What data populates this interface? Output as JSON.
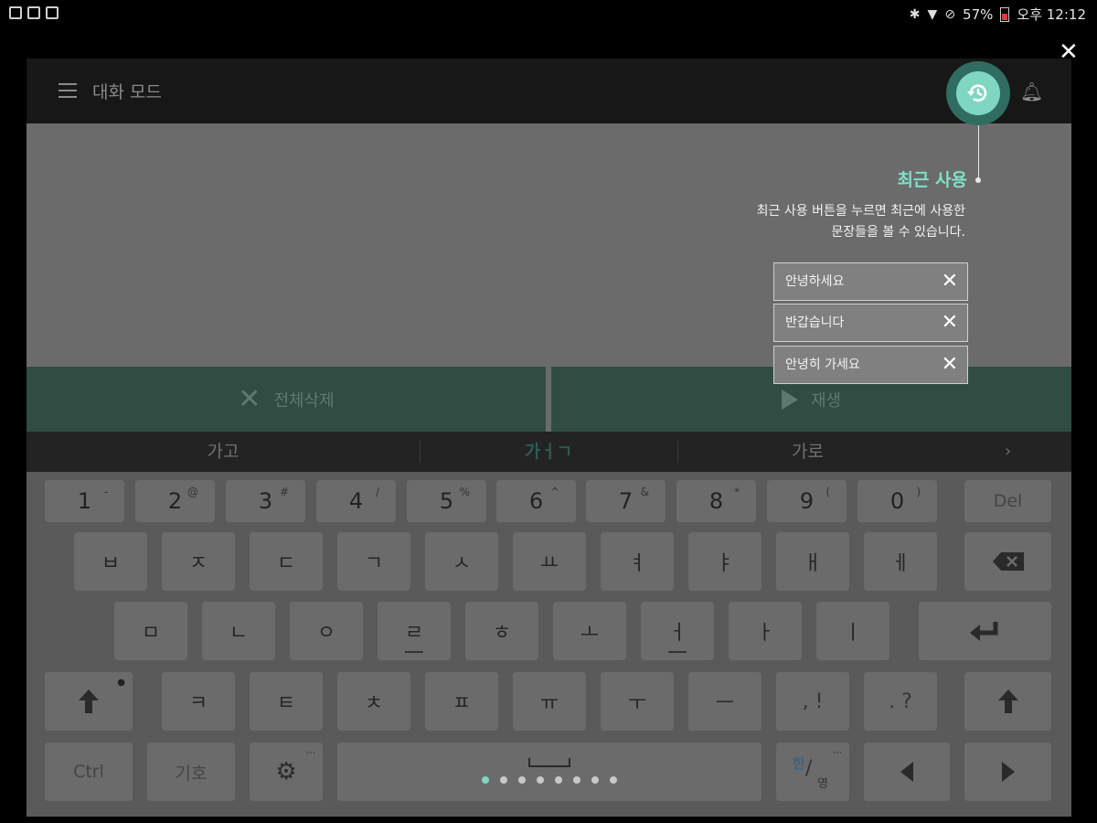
{
  "status_bar": {
    "battery": "57%",
    "time": "오후 12:12",
    "battery_level": 0.57
  },
  "app": {
    "title": "대화 모드"
  },
  "action_bar": {
    "clear_label": "전체삭제",
    "play_label": "재생"
  },
  "suggestions": {
    "items": [
      "가고",
      "가ㅓㄱ",
      "가로"
    ],
    "more": "›"
  },
  "keyboard": {
    "number_row": [
      {
        "main": "1",
        "alt": "-"
      },
      {
        "main": "2",
        "alt": "@"
      },
      {
        "main": "3",
        "alt": "#"
      },
      {
        "main": "4",
        "alt": "/"
      },
      {
        "main": "5",
        "alt": "%"
      },
      {
        "main": "6",
        "alt": "^"
      },
      {
        "main": "7",
        "alt": "&"
      },
      {
        "main": "8",
        "alt": "*"
      },
      {
        "main": "9",
        "alt": "("
      },
      {
        "main": "0",
        "alt": ")"
      }
    ],
    "del_label": "Del",
    "row1": [
      "ㅂ",
      "ㅈ",
      "ㄷ",
      "ㄱ",
      "ㅅ",
      "ㅛ",
      "ㅕ",
      "ㅑ",
      "ㅐ",
      "ㅔ"
    ],
    "row2": [
      "ㅁ",
      "ㄴ",
      "ㅇ",
      "ㄹ",
      "ㅎ",
      "ㅗ",
      "ㅓ",
      "ㅏ",
      "ㅣ"
    ],
    "row3": [
      "ㅋ",
      "ㅌ",
      "ㅊ",
      "ㅍ",
      "ㅠ",
      "ㅜ",
      "ㅡ",
      ", !",
      ". ?"
    ],
    "ctrl_label": "Ctrl",
    "symbol_label": "기호",
    "lang_label_top": "한",
    "lang_label_bottom": "영",
    "page_count": 8,
    "active_page": 0
  },
  "tooltip": {
    "title": "최근 사용",
    "description_line1": "최근 사용 버튼을 누르면 최근에 사용한",
    "description_line2": "문장들을 볼 수 있습니다.",
    "recent_items": [
      "안녕하세요",
      "반갑습니다",
      "안녕히 가세요"
    ]
  },
  "colors": {
    "accent": "#7fd7c1",
    "action_bar": "#2f4d42",
    "appbar": "#171717"
  }
}
